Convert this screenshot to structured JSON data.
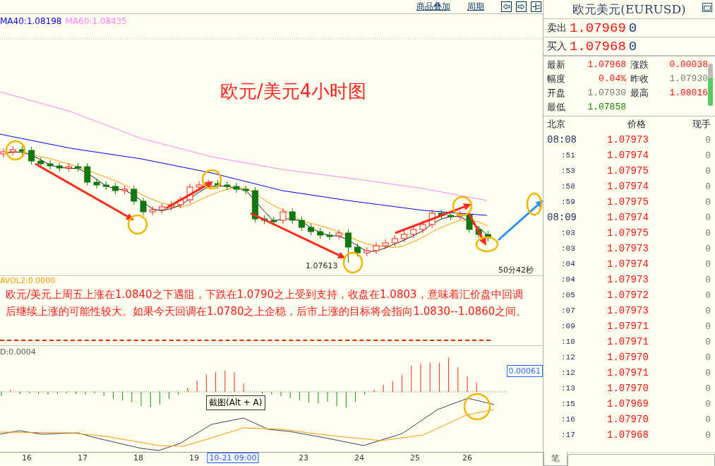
{
  "toolbar": {
    "links": [
      "商品叠加",
      "周期"
    ]
  },
  "chart": {
    "ma_legend": [
      {
        "label": "MA40:1.08198",
        "color": "#0000ff"
      },
      {
        "label": "MA60:1.08435",
        "color": "#ff80ff"
      }
    ],
    "title": "欧元/美元4小时图",
    "low_label": "1.07613",
    "countdown": "50分42秒"
  },
  "volume": {
    "label": "AVOL2:0.0000"
  },
  "commentary": "欧元/美元上周五上涨在1.0840之下遇阻，下跌在1.0790之上受到支持，收盘在1.0803，意味着汇价盘中回调后继续上涨的可能性较大。如果今天回调在1.0780之上企稳，后市上涨的目标将会指向1.0830--1.0860之间。",
  "macd": {
    "label": "D:0.0004",
    "value": "0.00061",
    "tooltip": "截图(Alt + A)"
  },
  "x_axis": [
    {
      "label": "16",
      "selected": false
    },
    {
      "label": "17",
      "selected": false
    },
    {
      "label": "18",
      "selected": false
    },
    {
      "label": "19",
      "selected": false
    },
    {
      "label": "10-21 09:00",
      "selected": true
    },
    {
      "label": "23",
      "selected": false
    },
    {
      "label": "24",
      "selected": false
    },
    {
      "label": "25",
      "selected": false
    },
    {
      "label": "26",
      "selected": false
    }
  ],
  "quote": {
    "title": "欧元美元(EURUSD)",
    "sell": {
      "label": "卖出",
      "price": "1.07969",
      "volume": "0"
    },
    "buy": {
      "label": "买入",
      "price": "1.07968",
      "volume": "0"
    },
    "stats": [
      {
        "label": "最新",
        "value": "1.07968",
        "color": "#ff1010"
      },
      {
        "label": "涨跌",
        "value": "0.00038",
        "color": "#ff1010"
      },
      {
        "label": "幅度",
        "value": "0.04%",
        "color": "#ff1010"
      },
      {
        "label": "昨收",
        "value": "1.07930",
        "color": "#777777"
      },
      {
        "label": "开盘",
        "value": "1.07930",
        "color": "#777777"
      },
      {
        "label": "最高",
        "value": "1.08016",
        "color": "#ff1010"
      },
      {
        "label": "最低",
        "value": "1.07858",
        "color": "#118811"
      }
    ],
    "columns": [
      "北京",
      "价格",
      "现手"
    ],
    "ticks": [
      {
        "time": "08:08",
        "kind": "full",
        "price": "1.07973",
        "volume": "0"
      },
      {
        "time": ":51",
        "kind": "minute",
        "price": "1.07974",
        "volume": "0"
      },
      {
        "time": ":53",
        "kind": "minute",
        "price": "1.07975",
        "volume": "0"
      },
      {
        "time": ":58",
        "kind": "minute",
        "price": "1.07974",
        "volume": "0"
      },
      {
        "time": ":59",
        "kind": "minute",
        "price": "1.07975",
        "volume": "0"
      },
      {
        "time": "08:09",
        "kind": "full",
        "price": "1.07974",
        "volume": "0"
      },
      {
        "time": ":03",
        "kind": "minute",
        "price": "1.07975",
        "volume": "0"
      },
      {
        "time": ":03",
        "kind": "minute",
        "price": "1.07973",
        "volume": "0"
      },
      {
        "time": ":04",
        "kind": "minute",
        "price": "1.07974",
        "volume": "0"
      },
      {
        "time": ":04",
        "kind": "minute",
        "price": "1.07973",
        "volume": "0"
      },
      {
        "time": ":05",
        "kind": "minute",
        "price": "1.07972",
        "volume": "0"
      },
      {
        "time": ":07",
        "kind": "minute",
        "price": "1.07973",
        "volume": "0"
      },
      {
        "time": ":09",
        "kind": "minute",
        "price": "1.07971",
        "volume": "0"
      },
      {
        "time": ":10",
        "kind": "minute",
        "price": "1.07971",
        "volume": "0"
      },
      {
        "time": ":12",
        "kind": "minute",
        "price": "1.07970",
        "volume": "0"
      },
      {
        "time": ":12",
        "kind": "minute",
        "price": "1.07971",
        "volume": "0"
      },
      {
        "time": ":13",
        "kind": "minute",
        "price": "1.07970",
        "volume": "0"
      },
      {
        "time": ":15",
        "kind": "minute",
        "price": "1.07969",
        "volume": "0"
      },
      {
        "time": ":16",
        "kind": "minute",
        "price": "1.07970",
        "volume": "0"
      },
      {
        "time": ":17",
        "kind": "minute",
        "price": "1.07968",
        "volume": "0"
      }
    ]
  },
  "tabs": [
    {
      "label": "笔",
      "selected": true
    }
  ]
}
